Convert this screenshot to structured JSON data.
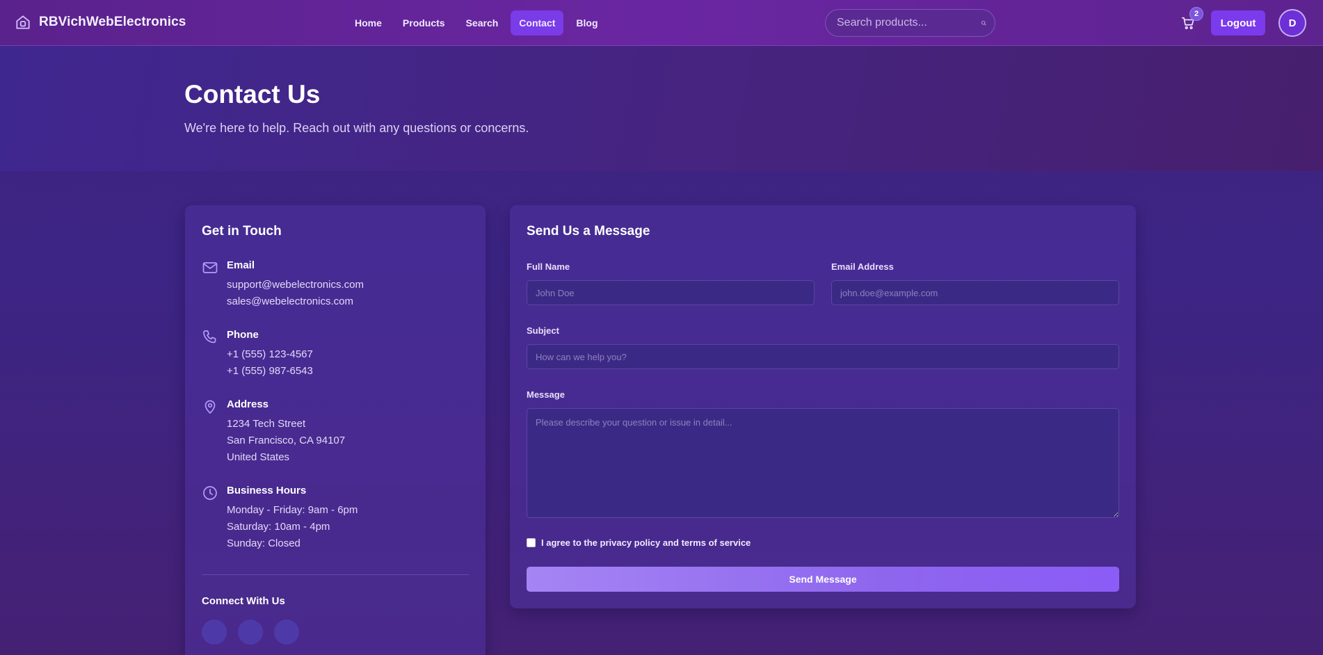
{
  "brand": {
    "name": "RBVichWebElectronics",
    "icon": "store-house-icon"
  },
  "nav": {
    "links": [
      {
        "label": "Home"
      },
      {
        "label": "Products"
      },
      {
        "label": "Search"
      },
      {
        "label": "Contact",
        "active": true
      },
      {
        "label": "Blog"
      }
    ]
  },
  "search": {
    "placeholder": "Search products..."
  },
  "cart": {
    "count": "2"
  },
  "user": {
    "logout_label": "Logout",
    "avatar_initial": "D"
  },
  "hero": {
    "title": "Contact Us",
    "subtitle": "We're here to help. Reach out with any questions or concerns."
  },
  "info": {
    "title": "Get in Touch",
    "email": {
      "label": "Email",
      "lines": [
        "support@webelectronics.com",
        "sales@webelectronics.com"
      ]
    },
    "phone": {
      "label": "Phone",
      "lines": [
        "+1 (555) 123-4567",
        "+1 (555) 987-6543"
      ]
    },
    "address": {
      "label": "Address",
      "lines": [
        "1234 Tech Street",
        "San Francisco, CA 94107",
        "United States"
      ]
    },
    "hours": {
      "label": "Business Hours",
      "lines": [
        "Monday - Friday: 9am - 6pm",
        "Saturday: 10am - 4pm",
        "Sunday: Closed"
      ]
    },
    "connect_title": "Connect With Us"
  },
  "form": {
    "title": "Send Us a Message",
    "full_name": {
      "label": "Full Name",
      "placeholder": "John Doe"
    },
    "email": {
      "label": "Email Address",
      "placeholder": "john.doe@example.com"
    },
    "subject": {
      "label": "Subject",
      "placeholder": "How can we help you?"
    },
    "message": {
      "label": "Message",
      "placeholder": "Please describe your question or issue in detail..."
    },
    "agree_label": "I agree to the privacy policy and terms of service",
    "submit_label": "Send Message"
  },
  "colors": {
    "accent": "#7c3aed",
    "nav_bg": "#6a26a2",
    "page_bg": "#3c2585",
    "icon": "#b69cf7"
  }
}
